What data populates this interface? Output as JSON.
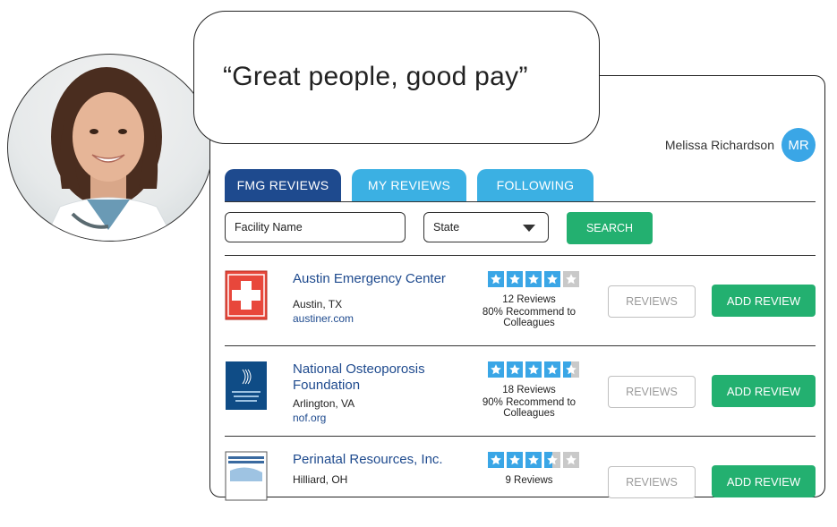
{
  "quote": "“Great people, good pay”",
  "user": {
    "name": "Melissa Richardson",
    "initials": "MR"
  },
  "tabs": [
    {
      "label": "FMG REVIEWS",
      "active": true
    },
    {
      "label": "MY REVIEWS",
      "active": false
    },
    {
      "label": "FOLLOWING",
      "active": false
    }
  ],
  "search": {
    "facility_placeholder": "Facility Name",
    "state_placeholder": "State",
    "button_label": "SEARCH"
  },
  "facilities": [
    {
      "name": "Austin Emergency Center",
      "location": "Austin, TX",
      "website": "austiner.com",
      "rating": 4,
      "reviews": "12 Reviews",
      "recommend": "80% Recommend to Colleagues",
      "reviews_button": "REVIEWS",
      "add_button": "ADD REVIEW"
    },
    {
      "name": "National Osteoporosis Foundation",
      "location": "Arlington, VA",
      "website": "nof.org",
      "rating": 4.5,
      "reviews": "18 Reviews",
      "recommend": "90% Recommend to Colleagues",
      "reviews_button": "REVIEWS",
      "add_button": "ADD REVIEW"
    },
    {
      "name": "Perinatal Resources, Inc.",
      "location": "Hilliard, OH",
      "website": "",
      "rating": 3.5,
      "reviews": "9 Reviews",
      "recommend": "",
      "reviews_button": "REVIEWS",
      "add_button": "ADD REVIEW"
    }
  ],
  "colors": {
    "brand_dark_blue": "#1e4a8e",
    "tab_light_blue": "#3bb0e3",
    "action_green": "#23b070",
    "star_blue": "#3aa6e6"
  }
}
